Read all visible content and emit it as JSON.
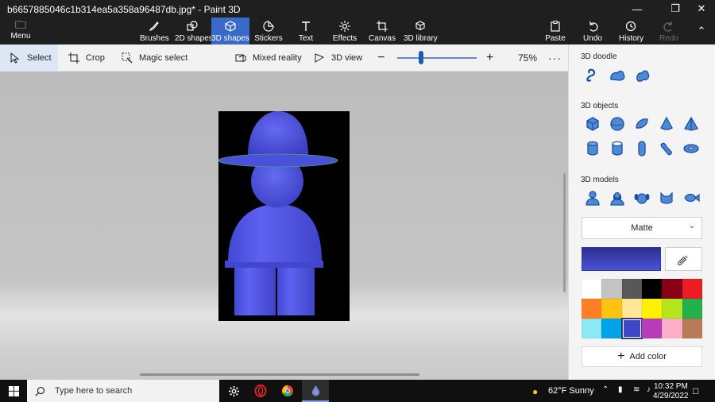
{
  "window": {
    "title": "b6657885046c1b314ea5a358a96487db.jpg* - Paint 3D",
    "controls": [
      "minimize-icon",
      "restore-icon",
      "close-icon"
    ]
  },
  "ribbon": {
    "menu_label": "Menu",
    "tools": [
      {
        "label": "Brushes",
        "icon": "brush-icon"
      },
      {
        "label": "2D shapes",
        "icon": "2d-shapes-icon"
      },
      {
        "label": "3D shapes",
        "icon": "3d-shapes-icon",
        "active": true
      },
      {
        "label": "Stickers",
        "icon": "stickers-icon"
      },
      {
        "label": "Text",
        "icon": "text-icon"
      },
      {
        "label": "Effects",
        "icon": "effects-icon"
      },
      {
        "label": "Canvas",
        "icon": "canvas-icon"
      },
      {
        "label": "3D library",
        "icon": "3d-library-icon"
      }
    ],
    "actions": [
      {
        "label": "Paste",
        "icon": "paste-icon"
      },
      {
        "label": "Undo",
        "icon": "undo-icon"
      },
      {
        "label": "History",
        "icon": "history-icon"
      },
      {
        "label": "Redo",
        "icon": "redo-icon",
        "disabled": true
      }
    ]
  },
  "toolbar": {
    "select_label": "Select",
    "crop_label": "Crop",
    "magic_select_label": "Magic select",
    "mixed_reality_label": "Mixed reality",
    "view_3d_label": "3D view",
    "zoom_level": "75%",
    "zoom_slider_value": 0.3
  },
  "panel": {
    "doodle_title": "3D doodle",
    "objects_title": "3D objects",
    "models_title": "3D models",
    "material": "Matte",
    "add_color_label": "Add color",
    "selected_color": "#3d47c9",
    "swatches": [
      "#ffffff",
      "#c3c3c3",
      "#585858",
      "#000000",
      "#880015",
      "#ed1c24",
      "#ff7f27",
      "#ffc20e",
      "#ffe699",
      "#fff200",
      "#b5e61d",
      "#22b14c",
      "#8ceaf7",
      "#00a2e8",
      "#3d47c9",
      "#b83dba",
      "#ffaec9",
      "#b97a57"
    ]
  },
  "taskbar": {
    "search_placeholder": "Type here to search",
    "weather": "62°F  Sunny",
    "time": "10:32 PM",
    "date": "4/29/2022"
  }
}
